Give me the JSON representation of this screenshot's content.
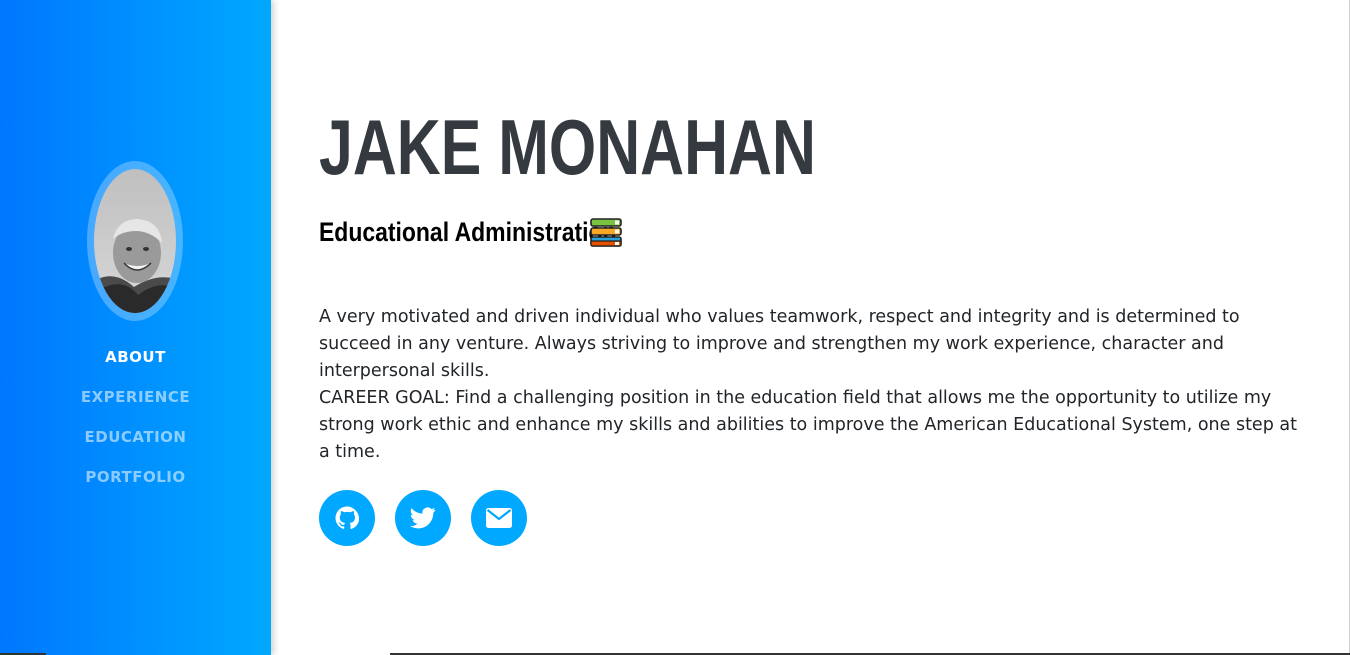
{
  "sidebar": {
    "nav": [
      {
        "label": "ABOUT",
        "active": true
      },
      {
        "label": "EXPERIENCE",
        "active": false
      },
      {
        "label": "EDUCATION",
        "active": false
      },
      {
        "label": "PORTFOLIO",
        "active": false
      }
    ],
    "gradient_start": "#0077ff",
    "gradient_end": "#00a8ff"
  },
  "profile": {
    "name": "JAKE MONAHAN",
    "subheading": "Educational Administration",
    "subheading_icon": "books-icon",
    "about": "A very motivated and driven individual who values teamwork, respect and integrity and is determined to succeed in any venture. Always striving to improve and strengthen my work experience, character and interpersonal skills.",
    "career_goal": "CAREER GOAL: Find a challenging position in the education field that allows me the opportunity to utilize my strong work ethic and enhance my skills and abilities to improve the American Educational System, one step at a time."
  },
  "social": [
    {
      "icon": "github-icon"
    },
    {
      "icon": "twitter-icon"
    },
    {
      "icon": "envelope-icon"
    }
  ],
  "colors": {
    "accent": "#00a8ff",
    "heading": "#343a40",
    "body_text": "#212529"
  }
}
